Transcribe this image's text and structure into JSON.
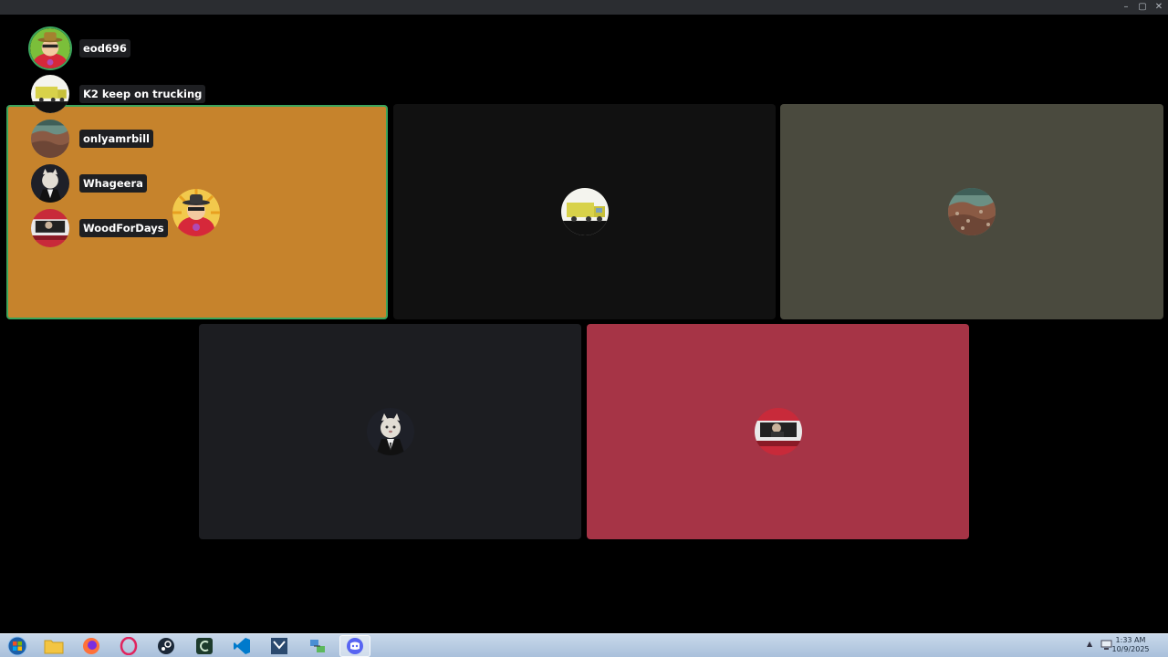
{
  "window": {
    "controls": {
      "minimize": "–",
      "maximize": "▢",
      "close": "✕"
    }
  },
  "tiles": [
    {
      "user": "eod696",
      "bg": "#c6832c",
      "speaking": true
    },
    {
      "user": "K2 keep on trucking",
      "bg": "#111111",
      "speaking": false
    },
    {
      "user": "onlyamrbill",
      "bg": "#4a4a3e",
      "speaking": false
    },
    {
      "user": "Whageera",
      "bg": "#1c1d21",
      "speaking": false
    },
    {
      "user": "WoodForDays",
      "bg": "#a63446",
      "speaking": false
    }
  ],
  "overlay": {
    "users": [
      {
        "name": "eod696",
        "avatar": "fedora-man-icon"
      },
      {
        "name": "K2 keep on trucking",
        "avatar": "truck-icon"
      },
      {
        "name": "onlyamrbill",
        "avatar": "rocky-landscape-icon"
      },
      {
        "name": "Whageera",
        "avatar": "cat-in-suit-icon"
      },
      {
        "name": "WoodForDays",
        "avatar": "car-driver-icon"
      }
    ]
  },
  "speaking_border_color": "#3ba55c",
  "taskbar": {
    "apps": [
      {
        "name": "start-button",
        "icon": "windows-orb-icon"
      },
      {
        "name": "file-explorer",
        "icon": "folder-icon"
      },
      {
        "name": "firefox",
        "icon": "firefox-icon"
      },
      {
        "name": "opera",
        "icon": "opera-icon"
      },
      {
        "name": "steam",
        "icon": "steam-icon"
      },
      {
        "name": "cheat-engine",
        "icon": "cheat-engine-icon"
      },
      {
        "name": "vscode",
        "icon": "vscode-icon"
      },
      {
        "name": "visual-studio",
        "icon": "visual-studio-icon"
      },
      {
        "name": "network-app",
        "icon": "network-icon"
      },
      {
        "name": "discord",
        "icon": "discord-icon",
        "active": true
      }
    ],
    "clock": {
      "time": "1:33 AM",
      "date": "10/9/2025"
    }
  }
}
